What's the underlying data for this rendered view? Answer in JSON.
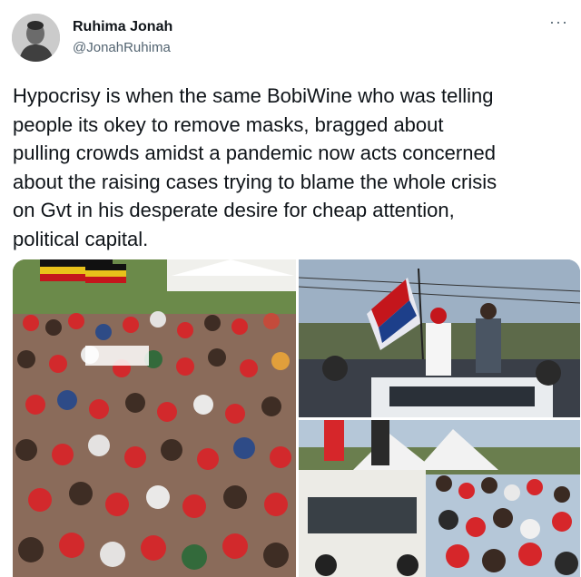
{
  "author": {
    "name": "Ruhima Jonah",
    "handle": "@JonahRuhima",
    "avatar_icon": "profile-photo-icon"
  },
  "more_label": "···",
  "tweet": {
    "text": "Hypocrisy is when the same BobiWine who was telling\npeople its okey to remove masks, bragged about\npulling crowds amidst a pandemic now acts concerned\nabout the raising cases trying to blame the whole crisis\non Gvt in his desperate desire for cheap attention,\npolitical capital."
  },
  "colors": {
    "text": "#0f1419",
    "secondary": "#536471",
    "crowd_red": "#d6262a",
    "tent_white": "#f2f2f2"
  }
}
